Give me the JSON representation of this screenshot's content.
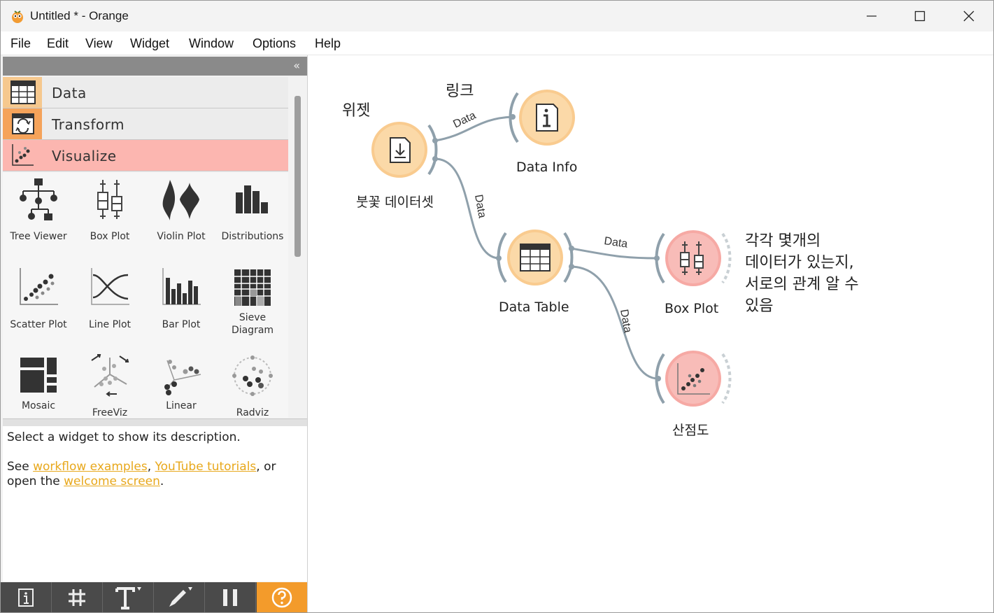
{
  "window": {
    "title": "Untitled * - Orange"
  },
  "menu": [
    "File",
    "Edit",
    "View",
    "Widget",
    "Window",
    "Options",
    "Help"
  ],
  "categories": [
    {
      "label": "Data",
      "icon": "table-icon"
    },
    {
      "label": "Transform",
      "icon": "transform-icon"
    },
    {
      "label": "Visualize",
      "icon": "visualize-icon",
      "selected": true
    }
  ],
  "widgets": [
    {
      "label": "Tree Viewer",
      "icon": "tree-viewer-icon"
    },
    {
      "label": "Box Plot",
      "icon": "box-plot-icon"
    },
    {
      "label": "Violin Plot",
      "icon": "violin-plot-icon"
    },
    {
      "label": "Distributions",
      "icon": "distributions-icon"
    },
    {
      "label": "Scatter Plot",
      "icon": "scatter-plot-icon"
    },
    {
      "label": "Line Plot",
      "icon": "line-plot-icon"
    },
    {
      "label": "Bar Plot",
      "icon": "bar-plot-icon"
    },
    {
      "label": "Sieve\nDiagram",
      "icon": "sieve-diagram-icon"
    },
    {
      "label": "Mosaic",
      "icon": "mosaic-icon"
    },
    {
      "label": "FreeViz",
      "icon": "freeviz-icon"
    },
    {
      "label": "Linear",
      "icon": "linear-projection-icon"
    },
    {
      "label": "Radviz",
      "icon": "radviz-icon"
    }
  ],
  "description": {
    "line1": "Select a widget to show its description.",
    "see": "See ",
    "link1": "workflow examples",
    "comma": ", ",
    "link2": "YouTube tutorials",
    "or": ", or",
    "open": "open the ",
    "link3": "welcome screen",
    "period": "."
  },
  "canvas": {
    "nodes": {
      "file": "붓꽃 데이터셋",
      "data_info": "Data Info",
      "data_table": "Data Table",
      "box_plot": "Box Plot",
      "scatter": "산점도"
    },
    "link_label": "Data",
    "annotations": {
      "widget": "위젯",
      "link": "링크",
      "note": [
        "각각 몇개의",
        "데이터가 있는지,",
        "서로의 관계 알 수",
        "있음"
      ]
    }
  },
  "colors": {
    "orange_node": "#fbd8a6",
    "orange_ring": "#f9c88a",
    "pink_node": "#f7b8b4",
    "selected_cat": "#fcb6b0",
    "link": "#8fa0ab",
    "help_button": "#f39b2b"
  }
}
